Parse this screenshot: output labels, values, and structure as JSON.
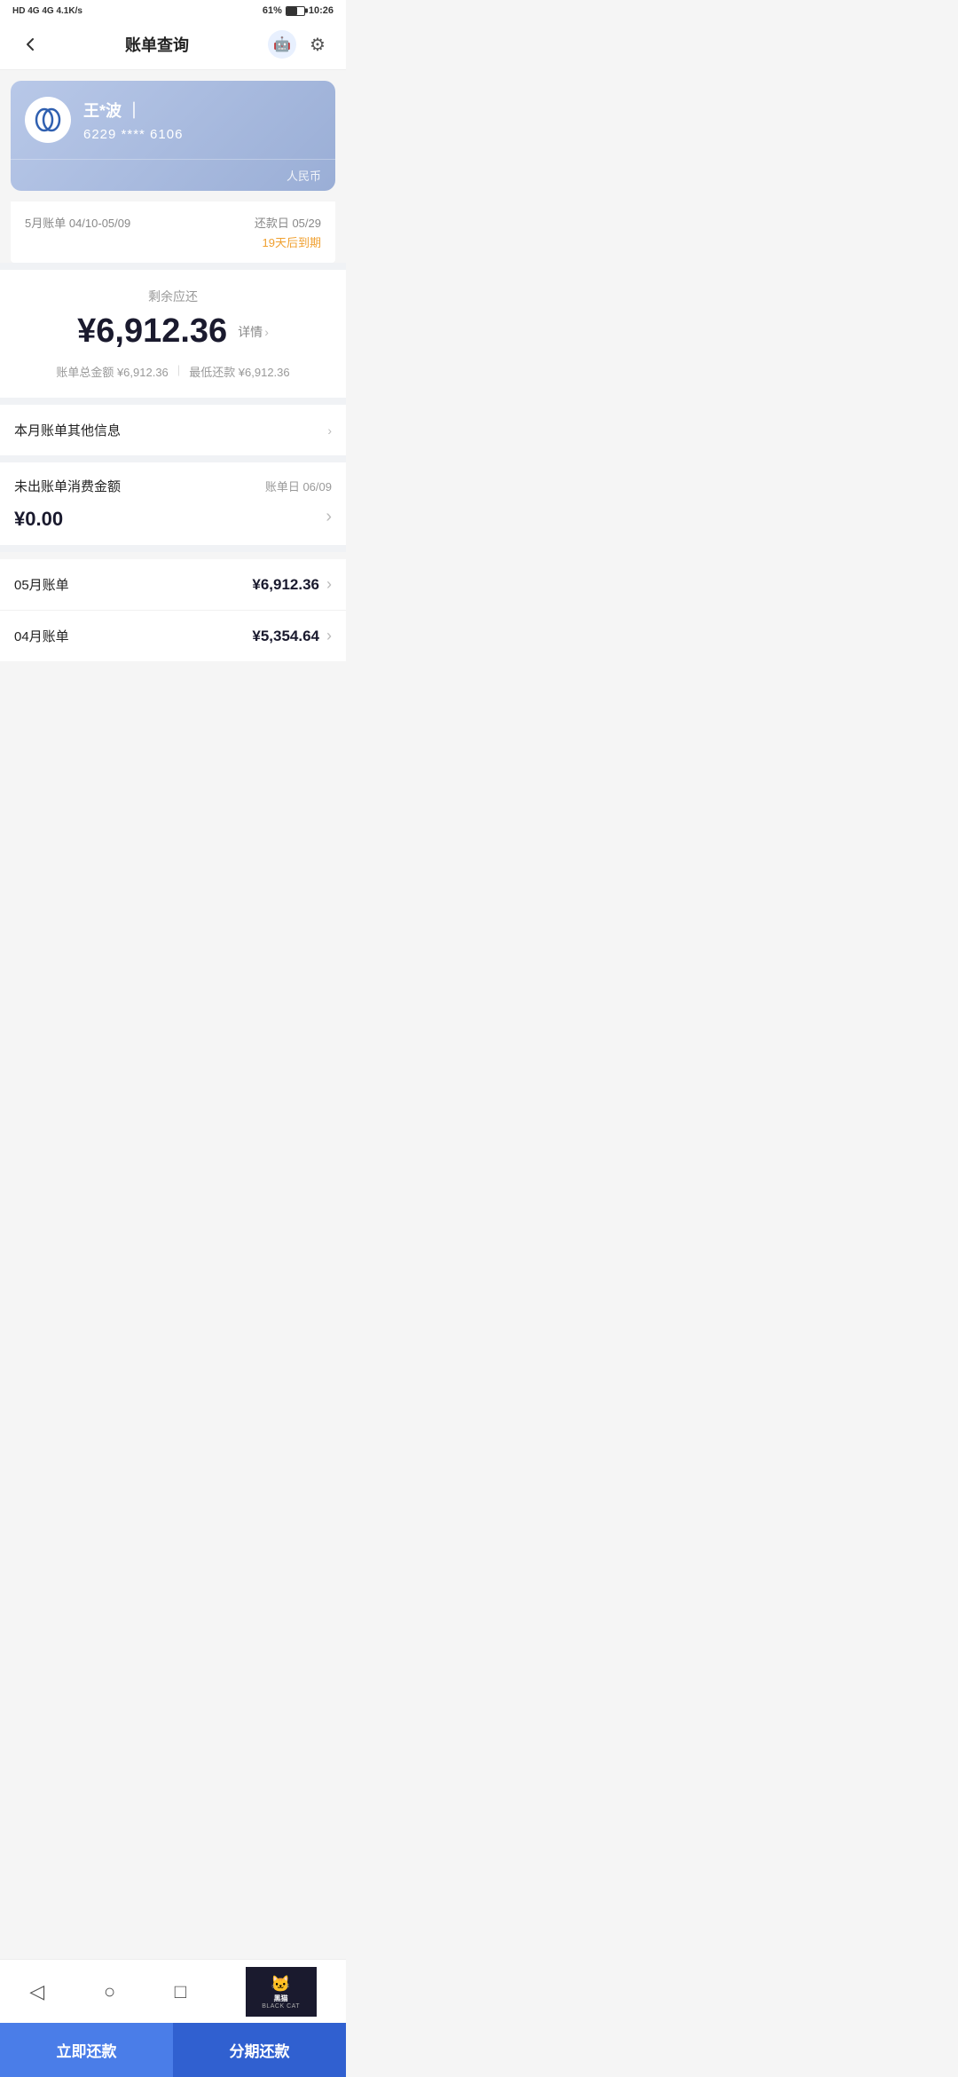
{
  "statusBar": {
    "network": "HD 4G 4G 4.1K/s",
    "battery": "61%",
    "time": "10:26"
  },
  "header": {
    "backLabel": "‹",
    "title": "账单查询",
    "avatarIcon": "🤖",
    "gearIcon": "⚙"
  },
  "card": {
    "name": "王*波",
    "nameSeparator": "｜",
    "number": "6229 **** 6106",
    "currency": "人民币"
  },
  "billing": {
    "periodLabel": "5月账单 04/10-05/09",
    "dueLabel": "还款日 05/29",
    "dueDays": "19天后到期"
  },
  "amount": {
    "label": "剩余应还",
    "value": "¥6,912.36",
    "detailLabel": "详情",
    "totalLabel": "账单总金额 ¥6,912.36",
    "minLabel": "最低还款 ¥6,912.36"
  },
  "infoRow": {
    "label": "本月账单其他信息"
  },
  "unpaid": {
    "label": "未出账单消费金额",
    "dateLabel": "账单日 06/09",
    "value": "¥0.00"
  },
  "bills": [
    {
      "month": "05月账单",
      "amount": "¥6,912.36"
    },
    {
      "month": "04月账单",
      "amount": "¥5,354.64"
    }
  ],
  "buttons": {
    "payNow": "立即还款",
    "installment": "分期还款"
  },
  "nav": {
    "back": "◁",
    "home": "○",
    "square": "□"
  },
  "watermark": {
    "icon": "🐱",
    "text": "黑猫",
    "subtext": "BLACK CAT"
  }
}
